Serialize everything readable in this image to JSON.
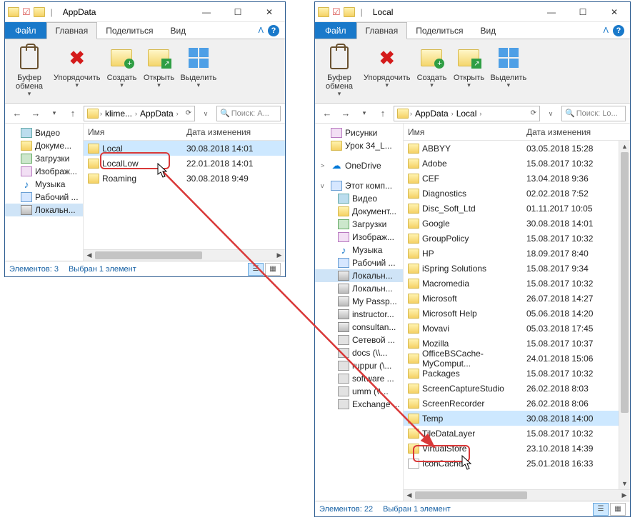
{
  "left": {
    "title": "AppData",
    "menu_file": "Файл",
    "menu_main": "Главная",
    "menu_share": "Поделиться",
    "menu_view": "Вид",
    "ribbon": {
      "buf": "Буфер\nобмена",
      "org": "Упорядочить",
      "new": "Создать",
      "open": "Открыть",
      "sel": "Выделить"
    },
    "addr": {
      "seg1": "klime...",
      "seg2": "AppData"
    },
    "search_ph": "Поиск: A...",
    "tree": [
      {
        "ico": "video",
        "label": "Видео"
      },
      {
        "ico": "folder",
        "label": "Докуме..."
      },
      {
        "ico": "down",
        "label": "Загрузки"
      },
      {
        "ico": "img",
        "label": "Изображ..."
      },
      {
        "ico": "music",
        "label": "Музыка"
      },
      {
        "ico": "desk",
        "label": "Рабочий ..."
      },
      {
        "ico": "disk",
        "label": "Локальн...",
        "sel": true
      }
    ],
    "cols": {
      "name": "Имя",
      "date": "Дата изменения"
    },
    "items": [
      {
        "name": "Local",
        "date": "30.08.2018 14:01",
        "sel": true
      },
      {
        "name": "LocalLow",
        "date": "22.01.2018 14:01"
      },
      {
        "name": "Roaming",
        "date": "30.08.2018 9:49"
      }
    ],
    "status_count": "Элементов: 3",
    "status_sel": "Выбран 1 элемент"
  },
  "right": {
    "title": "Local",
    "menu_file": "Файл",
    "menu_main": "Главная",
    "menu_share": "Поделиться",
    "menu_view": "Вид",
    "ribbon": {
      "buf": "Буфер\nобмена",
      "org": "Упорядочить",
      "new": "Создать",
      "open": "Открыть",
      "sel": "Выделить"
    },
    "addr": {
      "seg1": "AppData",
      "seg2": "Local"
    },
    "search_ph": "Поиск: Lo...",
    "tree": [
      {
        "ico": "img",
        "label": "Рисунки"
      },
      {
        "ico": "folder",
        "label": "Урок 34_L..."
      },
      {
        "ico": "blank",
        "label": ""
      },
      {
        "ico": "od",
        "label": "OneDrive",
        "exp": ">"
      },
      {
        "ico": "blank",
        "label": ""
      },
      {
        "ico": "pc",
        "label": "Этот комп...",
        "exp": "v"
      },
      {
        "ico": "video",
        "label": "Видео",
        "indent": 1
      },
      {
        "ico": "folder",
        "label": "Документ...",
        "indent": 1
      },
      {
        "ico": "down",
        "label": "Загрузки",
        "indent": 1
      },
      {
        "ico": "img",
        "label": "Изображ...",
        "indent": 1
      },
      {
        "ico": "music",
        "label": "Музыка",
        "indent": 1
      },
      {
        "ico": "desk",
        "label": "Рабочий ...",
        "indent": 1
      },
      {
        "ico": "disk",
        "label": "Локальн...",
        "indent": 1,
        "sel": true
      },
      {
        "ico": "disk",
        "label": "Локальн...",
        "indent": 1
      },
      {
        "ico": "disk",
        "label": "My Passp...",
        "indent": 1
      },
      {
        "ico": "disk",
        "label": "instructor...",
        "indent": 1
      },
      {
        "ico": "disk",
        "label": "consultan...",
        "indent": 1
      },
      {
        "ico": "net",
        "label": "Сетевой ...",
        "indent": 1
      },
      {
        "ico": "net",
        "label": "docs (\\\\...",
        "indent": 1
      },
      {
        "ico": "net",
        "label": "ruppur (\\...",
        "indent": 1
      },
      {
        "ico": "net",
        "label": "software ...",
        "indent": 1
      },
      {
        "ico": "net",
        "label": "umm (\\\\...",
        "indent": 1
      },
      {
        "ico": "net",
        "label": "Exchange ...",
        "indent": 1
      }
    ],
    "cols": {
      "name": "Имя",
      "date": "Дата изменения"
    },
    "items": [
      {
        "name": "ABBYY",
        "date": "03.05.2018 15:28"
      },
      {
        "name": "Adobe",
        "date": "15.08.2017 10:32"
      },
      {
        "name": "CEF",
        "date": "13.04.2018 9:36"
      },
      {
        "name": "Diagnostics",
        "date": "02.02.2018 7:52"
      },
      {
        "name": "Disc_Soft_Ltd",
        "date": "01.11.2017 10:05"
      },
      {
        "name": "Google",
        "date": "30.08.2018 14:01"
      },
      {
        "name": "GroupPolicy",
        "date": "15.08.2017 10:32"
      },
      {
        "name": "HP",
        "date": "18.09.2017 8:40"
      },
      {
        "name": "iSpring Solutions",
        "date": "15.08.2017 9:34"
      },
      {
        "name": "Macromedia",
        "date": "15.08.2017 10:32"
      },
      {
        "name": "Microsoft",
        "date": "26.07.2018 14:27"
      },
      {
        "name": "Microsoft Help",
        "date": "05.06.2018 14:20"
      },
      {
        "name": "Movavi",
        "date": "05.03.2018 17:45"
      },
      {
        "name": "Mozilla",
        "date": "15.08.2017 10:37"
      },
      {
        "name": "OfficeBSCache-MyComput...",
        "date": "24.01.2018 15:06"
      },
      {
        "name": "Packages",
        "date": "15.08.2017 10:32"
      },
      {
        "name": "ScreenCaptureStudio",
        "date": "26.02.2018 8:03"
      },
      {
        "name": "ScreenRecorder",
        "date": "26.02.2018 8:06"
      },
      {
        "name": "Temp",
        "date": "30.08.2018 14:00",
        "sel": true
      },
      {
        "name": "TileDataLayer",
        "date": "15.08.2017 10:32"
      },
      {
        "name": "VirtualStore",
        "date": "23.10.2018 14:39"
      },
      {
        "name": "IconCache",
        "date": "25.01.2018 16:33",
        "file": true
      }
    ],
    "status_count": "Элементов: 22",
    "status_sel": "Выбран 1 элемент"
  }
}
